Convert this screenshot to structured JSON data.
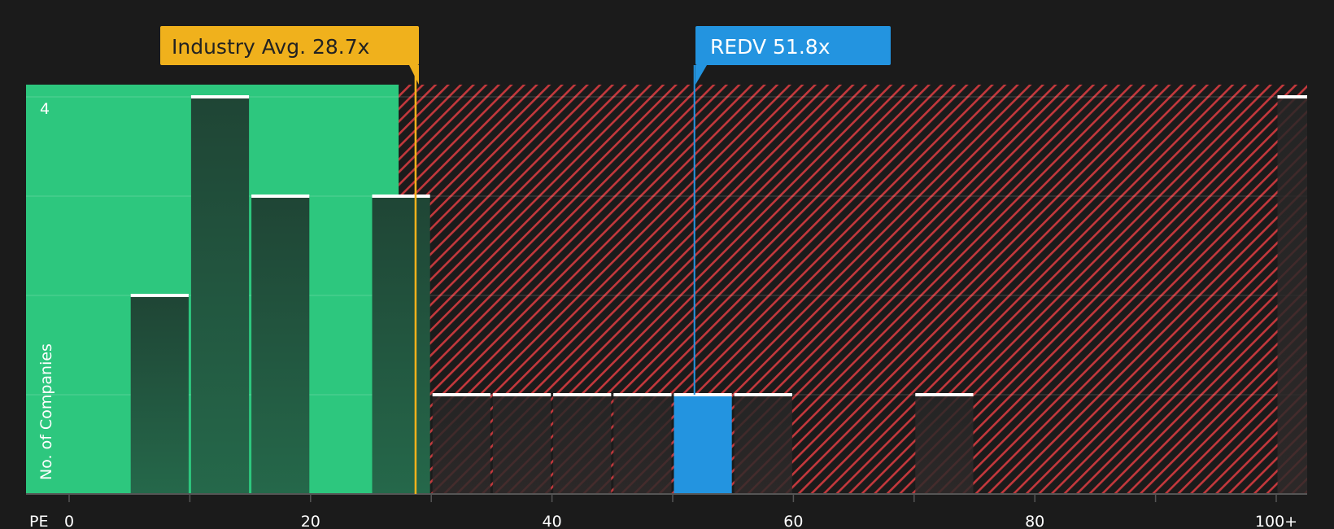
{
  "chart_data": {
    "type": "bar",
    "x_axis_label": "PE",
    "y_axis_label": "No. of Companies",
    "x_ticks": [
      {
        "value": 0,
        "label": "0"
      },
      {
        "value": 20,
        "label": "20"
      },
      {
        "value": 40,
        "label": "40"
      },
      {
        "value": 60,
        "label": "60"
      },
      {
        "value": 80,
        "label": "80"
      },
      {
        "value": 100,
        "label": "100+"
      }
    ],
    "y_ticks": [
      {
        "value": 4,
        "label": "4"
      }
    ],
    "xlim": [
      0,
      102.5
    ],
    "ylim": [
      0,
      4.14
    ],
    "bin_width": 5,
    "bins": [
      {
        "start": 5,
        "count": 2
      },
      {
        "start": 10,
        "count": 4
      },
      {
        "start": 15,
        "count": 3
      },
      {
        "start": 25,
        "count": 3
      },
      {
        "start": 30,
        "count": 1
      },
      {
        "start": 35,
        "count": 1
      },
      {
        "start": 40,
        "count": 1
      },
      {
        "start": 45,
        "count": 1
      },
      {
        "start": 50,
        "count": 1,
        "highlight": true
      },
      {
        "start": 55,
        "count": 1
      },
      {
        "start": 70,
        "count": 1
      },
      {
        "start": 100,
        "count": 4
      }
    ],
    "industry_avg": {
      "label": "Industry Avg. 28.7x",
      "value": 28.7
    },
    "company": {
      "label": "REDV 51.8x",
      "value": 51.8
    },
    "fair_zone_end": 27.3,
    "colors": {
      "background": "#1b1b1b",
      "fair_zone": "#2dc77e",
      "expensive_hatch": "#c3383c",
      "bar_fill": "#1f4a36",
      "bar_fill_red_zone": "#2a2a2a",
      "bar_cap": "#ffffff",
      "highlight": "#2394e0",
      "industry_callout": "#f0b11c",
      "grid": "rgba(255,255,255,0.13)",
      "axis": "#555555"
    }
  }
}
